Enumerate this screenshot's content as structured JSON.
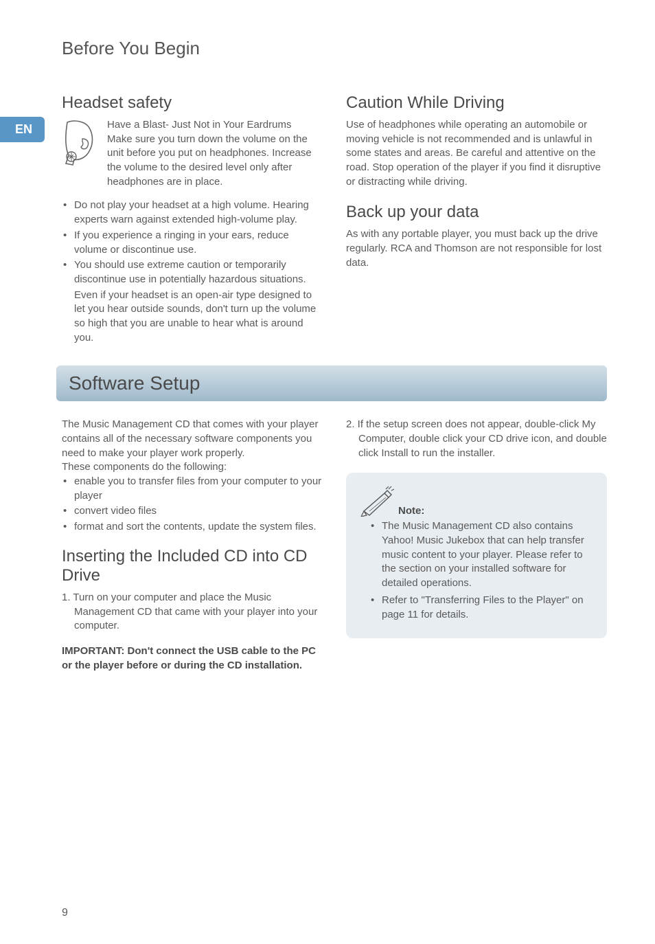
{
  "lang_tab": "EN",
  "page_number": "9",
  "page_title": "Before You Begin",
  "left_top": {
    "heading": "Headset safety",
    "blast_title": "Have a Blast- Just Not in Your Eardrums",
    "blast_body": "Make sure you turn down the volume on the unit before you put on headphones. Increase the volume to the desired level only after headphones are in place.",
    "bullets": [
      "Do not play your headset at a high volume. Hearing experts warn against extended high-volume play.",
      "If you experience a ringing in your ears, reduce volume or discontinue use.",
      "You should use extreme caution or temporarily discontinue use in potentially hazardous situations."
    ],
    "after_b3": "Even if your headset is an open-air type designed to let you hear outside sounds, don't turn up the volume so high that you are unable to hear what is around you."
  },
  "right_top": {
    "heading_caution": "Caution While Driving",
    "caution_body": "Use of headphones while operating an automobile or moving vehicle is not recommended and is unlawful in some states and areas. Be careful and attentive on the road. Stop operation of the player if you find it disruptive or distracting while driving.",
    "heading_backup": "Back up your data",
    "backup_body": "As with any portable player, you must back up the drive regularly. RCA and Thomson are not responsible for lost data."
  },
  "section_bar": "Software Setup",
  "left_bottom": {
    "intro": "The Music Management CD that comes with your player contains all of the necessary software components you need to make your player work properly.",
    "components_lead": "These components do the following:",
    "components": [
      "enable you to transfer files from your computer to your player",
      "convert video files",
      "format and sort the contents, update the system files."
    ],
    "sub_heading": "Inserting the Included CD into CD Drive",
    "step1": "1. Turn on your computer and place the Music Management CD that came with your player into your computer.",
    "important": "IMPORTANT: Don't connect the USB cable to the PC or the player before or during the CD installation."
  },
  "right_bottom": {
    "step2": "2. If the setup screen does not appear, double-click My Computer, double click your CD drive icon, and double click Install to run the installer.",
    "note_title": "Note:",
    "note_items": [
      "The Music Management CD also contains Yahoo! Music Jukebox that can help transfer music content to your player. Please refer to the section on your installed software for detailed operations.",
      "Refer to \"Transferring Files to the Player\" on page 11 for details."
    ]
  }
}
